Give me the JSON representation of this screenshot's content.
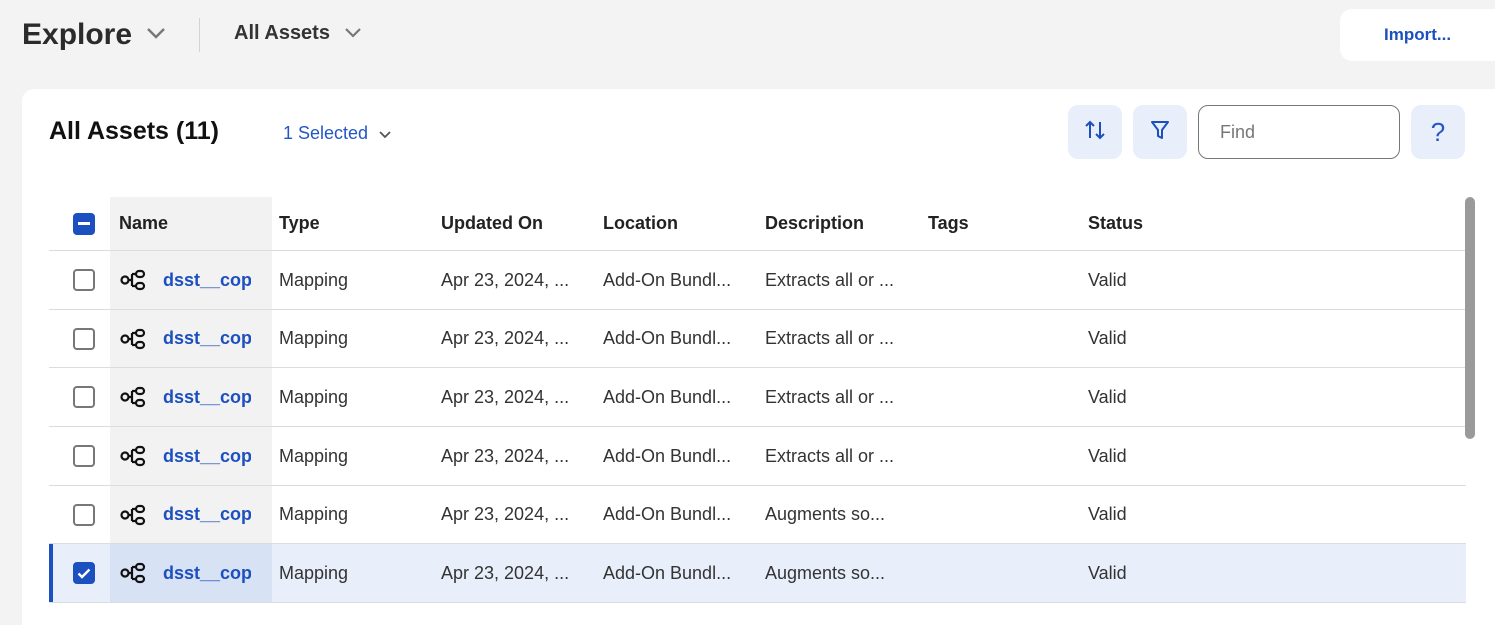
{
  "header": {
    "title": "Explore",
    "asset_filter": "All Assets",
    "import_label": "Import..."
  },
  "panel": {
    "title": "All Assets (11)",
    "selection_label": "1 Selected",
    "find_placeholder": "Find",
    "help_label": "?"
  },
  "table": {
    "columns": {
      "name": "Name",
      "type": "Type",
      "updated_on": "Updated On",
      "location": "Location",
      "description": "Description",
      "tags": "Tags",
      "status": "Status"
    },
    "rows": [
      {
        "name": "dsst__copy",
        "type": "Mapping",
        "updated_on": "Apr 23, 2024, ...",
        "location": "Add-On Bundl...",
        "description": "Extracts all or ...",
        "tags": "",
        "status": "Valid",
        "selected": false
      },
      {
        "name": "dsst__copy",
        "type": "Mapping",
        "updated_on": "Apr 23, 2024, ...",
        "location": "Add-On Bundl...",
        "description": "Extracts all or ...",
        "tags": "",
        "status": "Valid",
        "selected": false
      },
      {
        "name": "dsst__copy",
        "type": "Mapping",
        "updated_on": "Apr 23, 2024, ...",
        "location": "Add-On Bundl...",
        "description": "Extracts all or ...",
        "tags": "",
        "status": "Valid",
        "selected": false
      },
      {
        "name": "dsst__copy",
        "type": "Mapping",
        "updated_on": "Apr 23, 2024, ...",
        "location": "Add-On Bundl...",
        "description": "Extracts all or ...",
        "tags": "",
        "status": "Valid",
        "selected": false
      },
      {
        "name": "dsst__copy",
        "type": "Mapping",
        "updated_on": "Apr 23, 2024, ...",
        "location": "Add-On Bundl...",
        "description": "Augments so...",
        "tags": "",
        "status": "Valid",
        "selected": false
      },
      {
        "name": "dsst__copy",
        "type": "Mapping",
        "updated_on": "Apr 23, 2024, ...",
        "location": "Add-On Bundl...",
        "description": "Augments so...",
        "tags": "",
        "status": "Valid",
        "selected": true
      }
    ]
  },
  "icons": {
    "row_icon": "mapping-icon",
    "sort": "sort-icon",
    "filter": "filter-icon"
  },
  "colors": {
    "accent": "#1c4fbf",
    "selected_row": "#e8effb"
  }
}
